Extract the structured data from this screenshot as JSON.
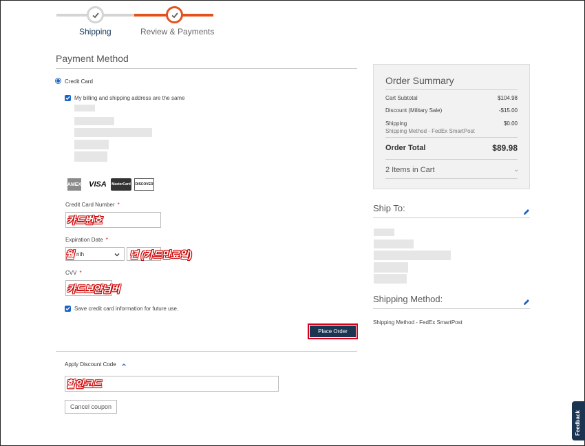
{
  "progress": {
    "steps": [
      {
        "label": "Shipping"
      },
      {
        "label": "Review & Payments"
      }
    ]
  },
  "payment": {
    "title": "Payment Method",
    "method_label": "Credit Card",
    "same_address_label": "My billing and shipping address are the same",
    "card_logos": {
      "amex": "AMEX",
      "visa": "VISA",
      "mastercard": "MasterCard",
      "discover": "DISCOVER"
    },
    "card_number_label": "Credit Card Number",
    "card_number_annotation": "카드번호",
    "required_mark": "*",
    "expiration_label": "Expiration Date",
    "month_annotation": "월",
    "month_placeholder": "nth",
    "year_annotation": "년 (카드만료일)",
    "cvv_label": "CVV",
    "cvv_annotation": "카드보안넘버",
    "save_card_label": "Save credit card information for future use.",
    "place_order_label": "Place Order"
  },
  "discount": {
    "toggle_label": "Apply Discount Code",
    "code_annotation": "할인코드",
    "cancel_label": "Cancel coupon"
  },
  "summary": {
    "title": "Order Summary",
    "subtotal_label": "Cart Subtotal",
    "subtotal_value": "$104.98",
    "discount_label": "Discount (Military Sale)",
    "discount_value": "-$15.00",
    "shipping_label": "Shipping",
    "shipping_sub": "Shipping Method - FedEx SmartPost",
    "shipping_value": "$0.00",
    "total_label": "Order Total",
    "total_value": "$89.98",
    "items_label": "2 Items in Cart",
    "items_chevron": "⌄"
  },
  "ship_to": {
    "title": "Ship To:"
  },
  "shipping_method": {
    "title": "Shipping Method:",
    "value": "Shipping Method - FedEx SmartPost"
  },
  "feedback": {
    "label": "Feedback"
  },
  "colors": {
    "accent_orange": "#e4521c",
    "navy": "#1a3452",
    "highlight_red": "#d6001c",
    "checkbox_blue": "#1a64c8"
  }
}
